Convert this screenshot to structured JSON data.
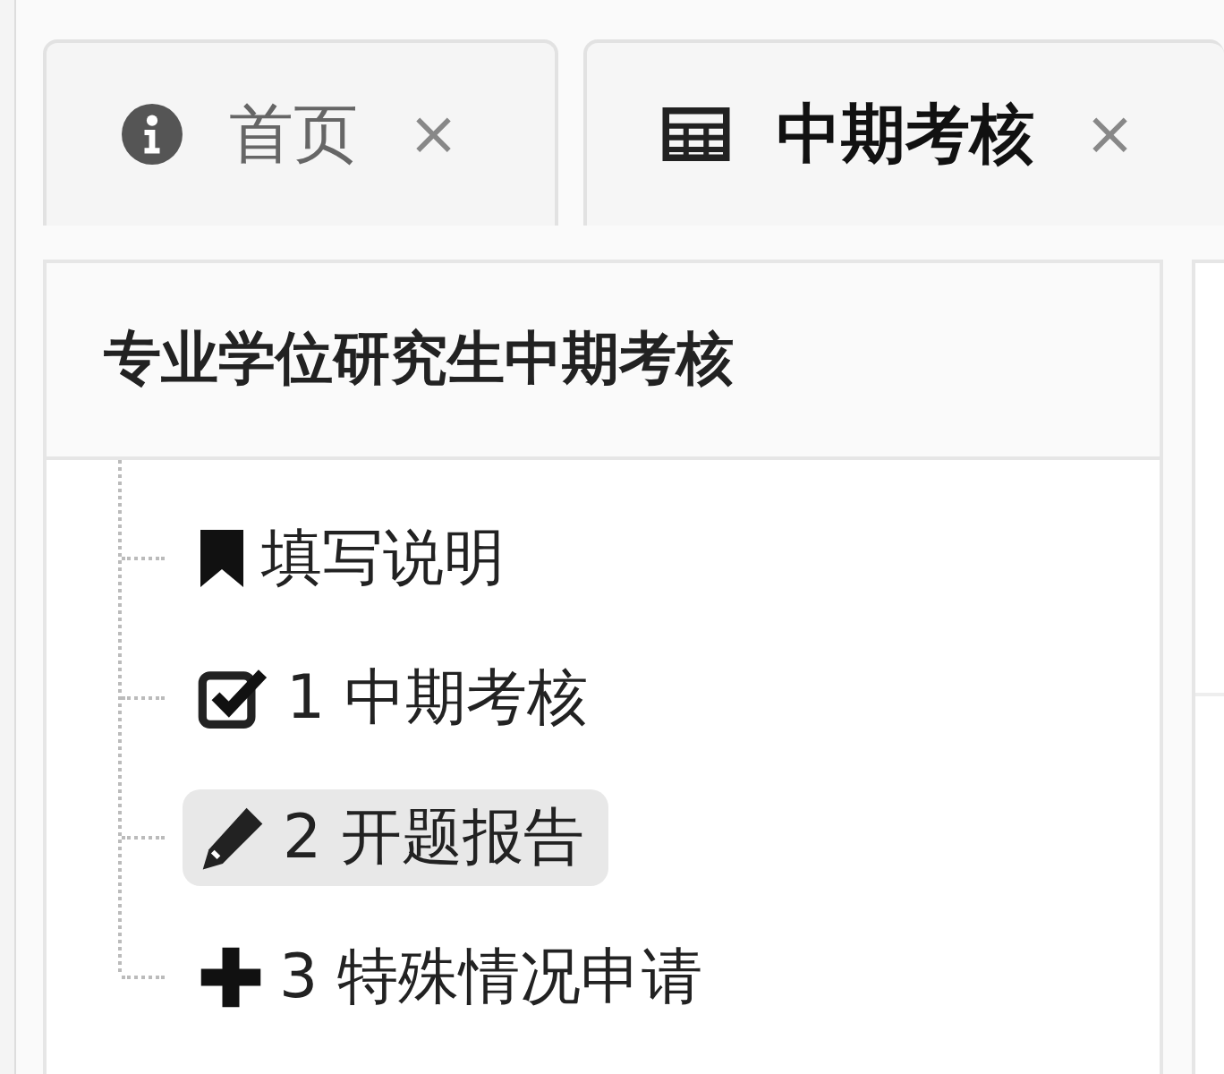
{
  "tabs": [
    {
      "kind": "info",
      "label": "首页",
      "close": "×",
      "selected": false
    },
    {
      "kind": "table",
      "label": "中期考核",
      "close": "×",
      "selected": true
    }
  ],
  "panel": {
    "title": "专业学位研究生中期考核",
    "items": [
      {
        "kind": "bookmark",
        "label": "填写说明",
        "selected": false
      },
      {
        "kind": "check",
        "label": "1 中期考核",
        "selected": false
      },
      {
        "kind": "pencil",
        "label": "2 开题报告",
        "selected": true
      },
      {
        "kind": "plus",
        "label": "3 特殊情况申请",
        "selected": false
      }
    ]
  }
}
